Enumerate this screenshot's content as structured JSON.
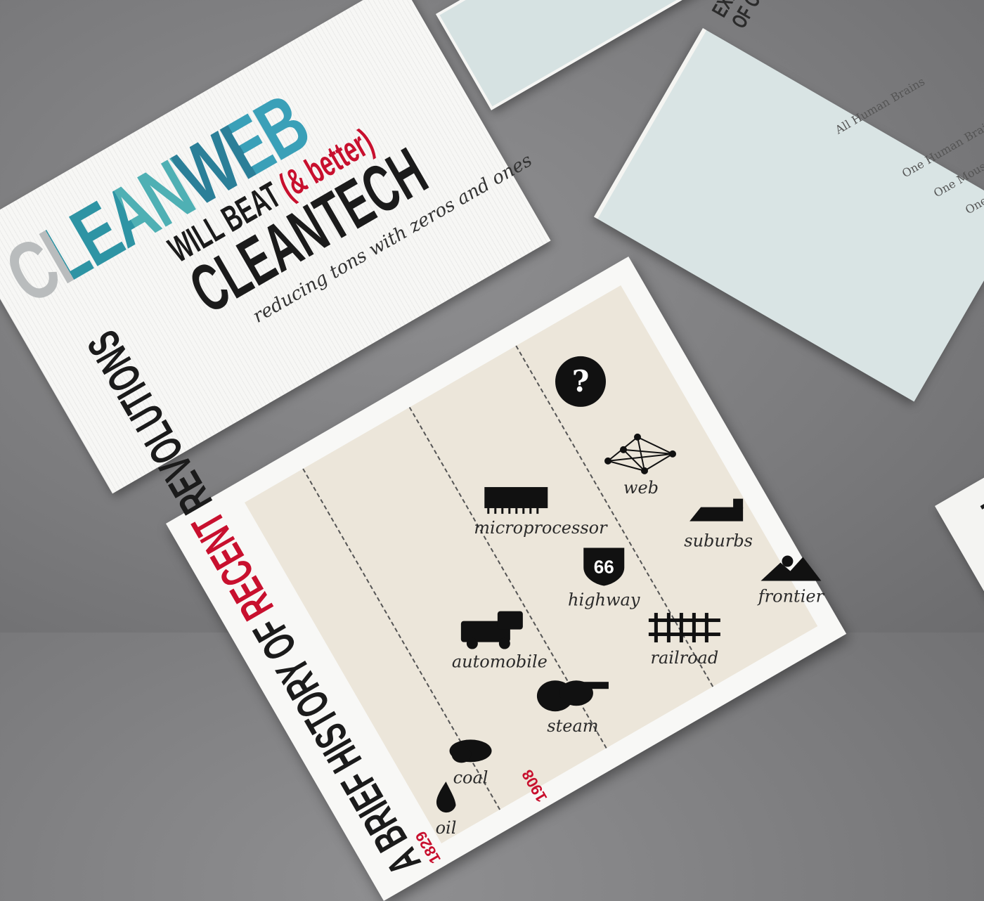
{
  "cleanweb_card": {
    "headline": "CLEANWEB",
    "line1_pre": "WILL BEAT ",
    "line1_red": "(& better)",
    "line2": "CLEANTECH",
    "tagline": "reducing tons with zeros and ones"
  },
  "computing_card": {
    "title_line1": "EXPONENTIAL GROWTH",
    "title_line2": "OF COMPUTING",
    "labels": [
      "All Human Brains",
      "One Human Brain",
      "One Mouse B",
      "One"
    ]
  },
  "revolutions_card": {
    "title_pre": "A BRIEF HISTORY OF ",
    "title_red": "RECENT",
    "title_post": " REVOLUTIONS",
    "years": [
      "1829",
      "1908"
    ],
    "items": [
      {
        "label": "coal",
        "icon": "coal-icon"
      },
      {
        "label": "oil",
        "icon": "oil-drop-icon"
      },
      {
        "label": "steam",
        "icon": "steam-icon"
      },
      {
        "label": "automobile",
        "icon": "automobile-icon"
      },
      {
        "label": "railroad",
        "icon": "railroad-track-icon"
      },
      {
        "label": "highway",
        "icon": "highway-66-shield-icon",
        "shield_text": "66"
      },
      {
        "label": "microprocessor",
        "icon": "microprocessor-icon"
      },
      {
        "label": "frontier",
        "icon": "mountain-sun-icon"
      },
      {
        "label": "suburbs",
        "icon": "house-icon"
      },
      {
        "label": "web",
        "icon": "network-web-icon"
      },
      {
        "label": "",
        "icon": "question-mark-icon",
        "symbol": "?"
      }
    ]
  },
  "edge_card": {
    "text": "ON IN"
  },
  "colors": {
    "background": "#7f7f81",
    "accent_red": "#c8102e",
    "card_cream": "#ece6da",
    "teal": "#2e94a4"
  }
}
